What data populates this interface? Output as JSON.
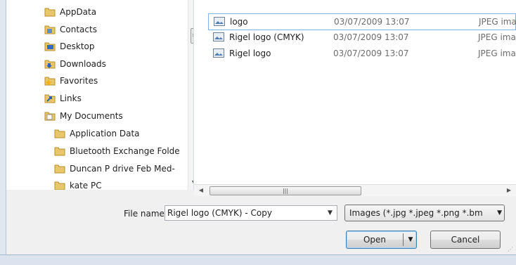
{
  "nav_tree": {
    "items": [
      {
        "label": "AppData",
        "icon": "folder-icon"
      },
      {
        "label": "Contacts",
        "icon": "contacts-folder-icon"
      },
      {
        "label": "Desktop",
        "icon": "desktop-folder-icon"
      },
      {
        "label": "Downloads",
        "icon": "downloads-folder-icon"
      },
      {
        "label": "Favorites",
        "icon": "favorites-folder-icon"
      },
      {
        "label": "Links",
        "icon": "links-folder-icon"
      },
      {
        "label": "My Documents",
        "icon": "documents-folder-icon"
      },
      {
        "label": "Application Data",
        "icon": "folder-icon"
      },
      {
        "label": "Bluetooth Exchange Folde",
        "icon": "folder-icon"
      },
      {
        "label": "Duncan P drive Feb Med-",
        "icon": "folder-icon"
      },
      {
        "label": "kate PC",
        "icon": "folder-icon"
      }
    ]
  },
  "file_list": {
    "rows": [
      {
        "name": "logo",
        "date": "03/07/2009 13:07",
        "type": "JPEG image",
        "selected": true
      },
      {
        "name": "Rigel logo (CMYK)",
        "date": "03/07/2009 13:07",
        "type": "JPEG image",
        "selected": false
      },
      {
        "name": "Rigel logo",
        "date": "03/07/2009 13:07",
        "type": "JPEG image",
        "selected": false
      }
    ]
  },
  "footer": {
    "file_name_label": "File name:",
    "file_name_value": "Rigel logo (CMYK) - Copy",
    "file_type_value": "Images (*.jpg *.jpeg *.png *.bm",
    "open_label": "Open",
    "cancel_label": "Cancel"
  },
  "colors": {
    "selection_border": "#7eb4ea",
    "window_background": "#f0f0f0"
  }
}
